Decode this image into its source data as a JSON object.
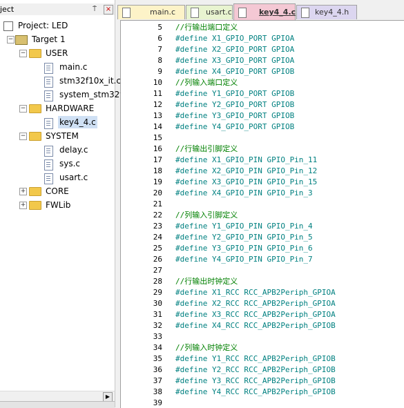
{
  "project_panel": {
    "title": "ject",
    "pin_glyph": "⍑",
    "close_glyph": "×",
    "tree": [
      {
        "label": "Project: LED",
        "level": 0,
        "kind": "project"
      },
      {
        "label": "Target 1",
        "level": 1,
        "kind": "target",
        "expand": "−"
      },
      {
        "label": "USER",
        "level": 2,
        "kind": "folder",
        "expand": "−"
      },
      {
        "label": "main.c",
        "level": 3,
        "kind": "file"
      },
      {
        "label": "stm32f10x_it.c",
        "level": 3,
        "kind": "file"
      },
      {
        "label": "system_stm32f",
        "level": 3,
        "kind": "file"
      },
      {
        "label": "HARDWARE",
        "level": 2,
        "kind": "folder",
        "expand": "−"
      },
      {
        "label": "key4_4.c",
        "level": 3,
        "kind": "file",
        "selected": true
      },
      {
        "label": "SYSTEM",
        "level": 2,
        "kind": "folder",
        "expand": "−"
      },
      {
        "label": "delay.c",
        "level": 3,
        "kind": "file"
      },
      {
        "label": "sys.c",
        "level": 3,
        "kind": "file"
      },
      {
        "label": "usart.c",
        "level": 3,
        "kind": "file"
      },
      {
        "label": "CORE",
        "level": 2,
        "kind": "folder",
        "expand": "+"
      },
      {
        "label": "FWLib",
        "level": 2,
        "kind": "folder",
        "expand": "+"
      }
    ]
  },
  "tabs": [
    {
      "label": "main.c",
      "active": false
    },
    {
      "label": "usart.c",
      "active": false
    },
    {
      "label": "key4_4.c",
      "active": true
    },
    {
      "label": "key4_4.h",
      "active": false
    }
  ],
  "editor": {
    "lines": [
      {
        "n": "5",
        "text": "//行输出端口定义",
        "kind": "cm"
      },
      {
        "n": "6",
        "text": "#define X1_GPIO_PORT GPIOA",
        "kind": "pp"
      },
      {
        "n": "7",
        "text": "#define X2_GPIO_PORT GPIOA",
        "kind": "pp"
      },
      {
        "n": "8",
        "text": "#define X3_GPIO_PORT GPIOA",
        "kind": "pp"
      },
      {
        "n": "9",
        "text": "#define X4_GPIO_PORT GPIOB",
        "kind": "pp"
      },
      {
        "n": "10",
        "text": "//列输入端口定义",
        "kind": "cm"
      },
      {
        "n": "11",
        "text": "#define Y1_GPIO_PORT GPIOB",
        "kind": "pp"
      },
      {
        "n": "12",
        "text": "#define Y2_GPIO_PORT GPIOB",
        "kind": "pp"
      },
      {
        "n": "13",
        "text": "#define Y3_GPIO_PORT GPIOB",
        "kind": "pp"
      },
      {
        "n": "14",
        "text": "#define Y4_GPIO_PORT GPIOB",
        "kind": "pp"
      },
      {
        "n": "15",
        "text": "",
        "kind": "tx"
      },
      {
        "n": "16",
        "text": "//行输出引脚定义",
        "kind": "cm"
      },
      {
        "n": "17",
        "text": "#define X1_GPIO_PIN GPIO_Pin_11",
        "kind": "pp"
      },
      {
        "n": "18",
        "text": "#define X2_GPIO_PIN GPIO_Pin_12",
        "kind": "pp"
      },
      {
        "n": "19",
        "text": "#define X3_GPIO_PIN GPIO_Pin_15",
        "kind": "pp"
      },
      {
        "n": "20",
        "text": "#define X4_GPIO_PIN GPIO_Pin_3",
        "kind": "pp"
      },
      {
        "n": "21",
        "text": "",
        "kind": "tx"
      },
      {
        "n": "22",
        "text": "//列输入引脚定义",
        "kind": "cm"
      },
      {
        "n": "23",
        "text": "#define Y1_GPIO_PIN GPIO_Pin_4",
        "kind": "pp"
      },
      {
        "n": "24",
        "text": "#define Y2_GPIO_PIN GPIO_Pin_5",
        "kind": "pp"
      },
      {
        "n": "25",
        "text": "#define Y3_GPIO_PIN GPIO_Pin_6",
        "kind": "pp"
      },
      {
        "n": "26",
        "text": "#define Y4_GPIO_PIN GPIO_Pin_7",
        "kind": "pp"
      },
      {
        "n": "27",
        "text": "",
        "kind": "tx"
      },
      {
        "n": "28",
        "text": "//行输出时钟定义",
        "kind": "cm"
      },
      {
        "n": "29",
        "text": "#define X1_RCC RCC_APB2Periph_GPIOA",
        "kind": "pp"
      },
      {
        "n": "30",
        "text": "#define X2_RCC RCC_APB2Periph_GPIOA",
        "kind": "pp"
      },
      {
        "n": "31",
        "text": "#define X3_RCC RCC_APB2Periph_GPIOA",
        "kind": "pp"
      },
      {
        "n": "32",
        "text": "#define X4_RCC RCC_APB2Periph_GPIOB",
        "kind": "pp"
      },
      {
        "n": "33",
        "text": "",
        "kind": "tx"
      },
      {
        "n": "34",
        "text": "//列输入时钟定义",
        "kind": "cm"
      },
      {
        "n": "35",
        "text": "#define Y1_RCC RCC_APB2Periph_GPIOB",
        "kind": "pp"
      },
      {
        "n": "36",
        "text": "#define Y2_RCC RCC_APB2Periph_GPIOB",
        "kind": "pp"
      },
      {
        "n": "37",
        "text": "#define Y3_RCC RCC_APB2Periph_GPIOB",
        "kind": "pp"
      },
      {
        "n": "38",
        "text": "#define Y4_RCC RCC_APB2Periph_GPIOB",
        "kind": "pp"
      },
      {
        "n": "39",
        "text": "",
        "kind": "tx"
      }
    ]
  },
  "colors": {
    "comment": "#008000",
    "preprocessor": "#008080",
    "selected_row": "#cfe0f4"
  }
}
